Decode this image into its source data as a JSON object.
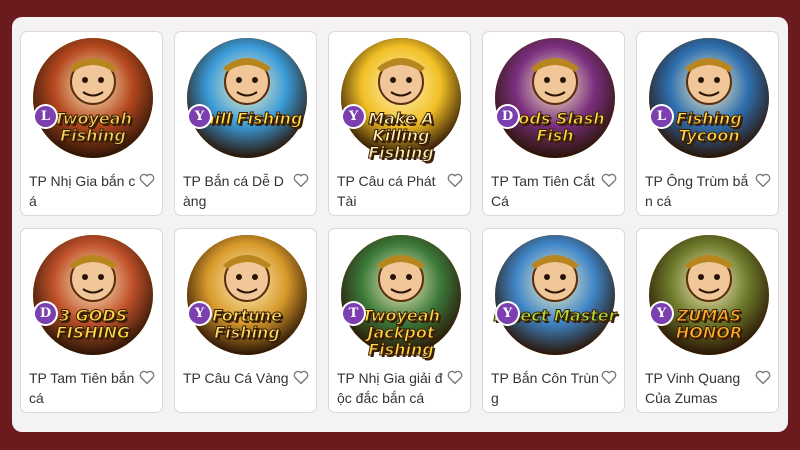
{
  "colors": {
    "page_background": "#6b1a1e",
    "panel_background": "#f4f2f3",
    "badge_purple": "#7b3fb0",
    "ring_gold": "#c9962b"
  },
  "games": [
    {
      "name": "TP Nhị Gia bắn cá",
      "logo": "Twoyeah Fishing",
      "badge": "L",
      "favorite_icon": "heart-outline-icon",
      "bg": "#b5471e",
      "logo_color": "#f6d35c"
    },
    {
      "name": "TP Bắn cá Dễ Dàng",
      "logo": "Chill Fishing",
      "badge": "Y",
      "favorite_icon": "heart-outline-icon",
      "bg": "#3a9bd8",
      "logo_color": "#ffe14a"
    },
    {
      "name": "TP Câu cá Phát Tài",
      "logo": "Make A Killing Fishing",
      "badge": "Y",
      "favorite_icon": "heart-outline-icon",
      "bg": "#f2c025",
      "logo_color": "#fff2b0"
    },
    {
      "name": "TP Tam Tiên Cắt Cá",
      "logo": "Gods Slash Fish",
      "badge": "D",
      "favorite_icon": "heart-outline-icon",
      "bg": "#7a2f7f",
      "logo_color": "#ffd84a"
    },
    {
      "name": "TP Ông Trùm bắn cá",
      "logo": "Fishing Tycoon",
      "badge": "L",
      "favorite_icon": "heart-outline-icon",
      "bg": "#2e6fb0",
      "logo_color": "#ffd84a"
    },
    {
      "name": "TP Tam Tiên bắn cá",
      "logo": "3 GODS FISHING",
      "badge": "D",
      "favorite_icon": "heart-outline-icon",
      "bg": "#c0512a",
      "logo_color": "#ffd84a"
    },
    {
      "name": "TP Câu Cá Vàng",
      "logo": "Fortune Fishing",
      "badge": "Y",
      "favorite_icon": "heart-outline-icon",
      "bg": "#d89a2a",
      "logo_color": "#ffe066"
    },
    {
      "name": "TP Nhị Gia giải độc đắc bắn cá",
      "logo": "Twoyeah Jackpot Fishing",
      "badge": "T",
      "favorite_icon": "heart-outline-icon",
      "bg": "#3b7a3a",
      "logo_color": "#ffd84a"
    },
    {
      "name": "TP Bắn Côn Trùng",
      "logo": "Insect Master",
      "badge": "Y",
      "favorite_icon": "heart-outline-icon",
      "bg": "#3f86c8",
      "logo_color": "#a8e23a"
    },
    {
      "name": "TP Vinh Quang Của Zumas",
      "logo": "ZUMAS HONOR",
      "badge": "Y",
      "favorite_icon": "heart-outline-icon",
      "bg": "#6c7a2a",
      "logo_color": "#ffb02a"
    }
  ]
}
